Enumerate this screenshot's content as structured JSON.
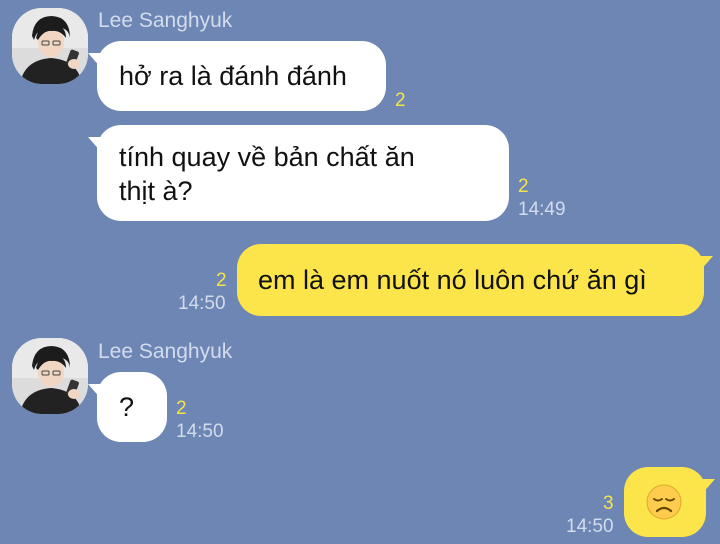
{
  "messages": {
    "m1": {
      "sender": "Lee Sanghyuk",
      "text": "hở ra là đánh đánh",
      "unread": "2"
    },
    "m2": {
      "text": "tính quay về bản chất ăn\nthịt à?",
      "unread": "2",
      "time": "14:49"
    },
    "m3": {
      "text": "em là em nuốt nó luôn chứ ăn gì",
      "unread": "2",
      "time": "14:50"
    },
    "m4": {
      "sender": "Lee Sanghyuk",
      "text": "?",
      "unread": "2",
      "time": "14:50"
    },
    "m5": {
      "emoji": "disappointed-face",
      "unread": "3",
      "time": "14:50"
    }
  },
  "colors": {
    "background": "#6d86b4",
    "incoming_bubble": "#ffffff",
    "outgoing_bubble": "#fce54b",
    "unread_count": "#f7e44a",
    "meta_text": "#d3dced"
  }
}
